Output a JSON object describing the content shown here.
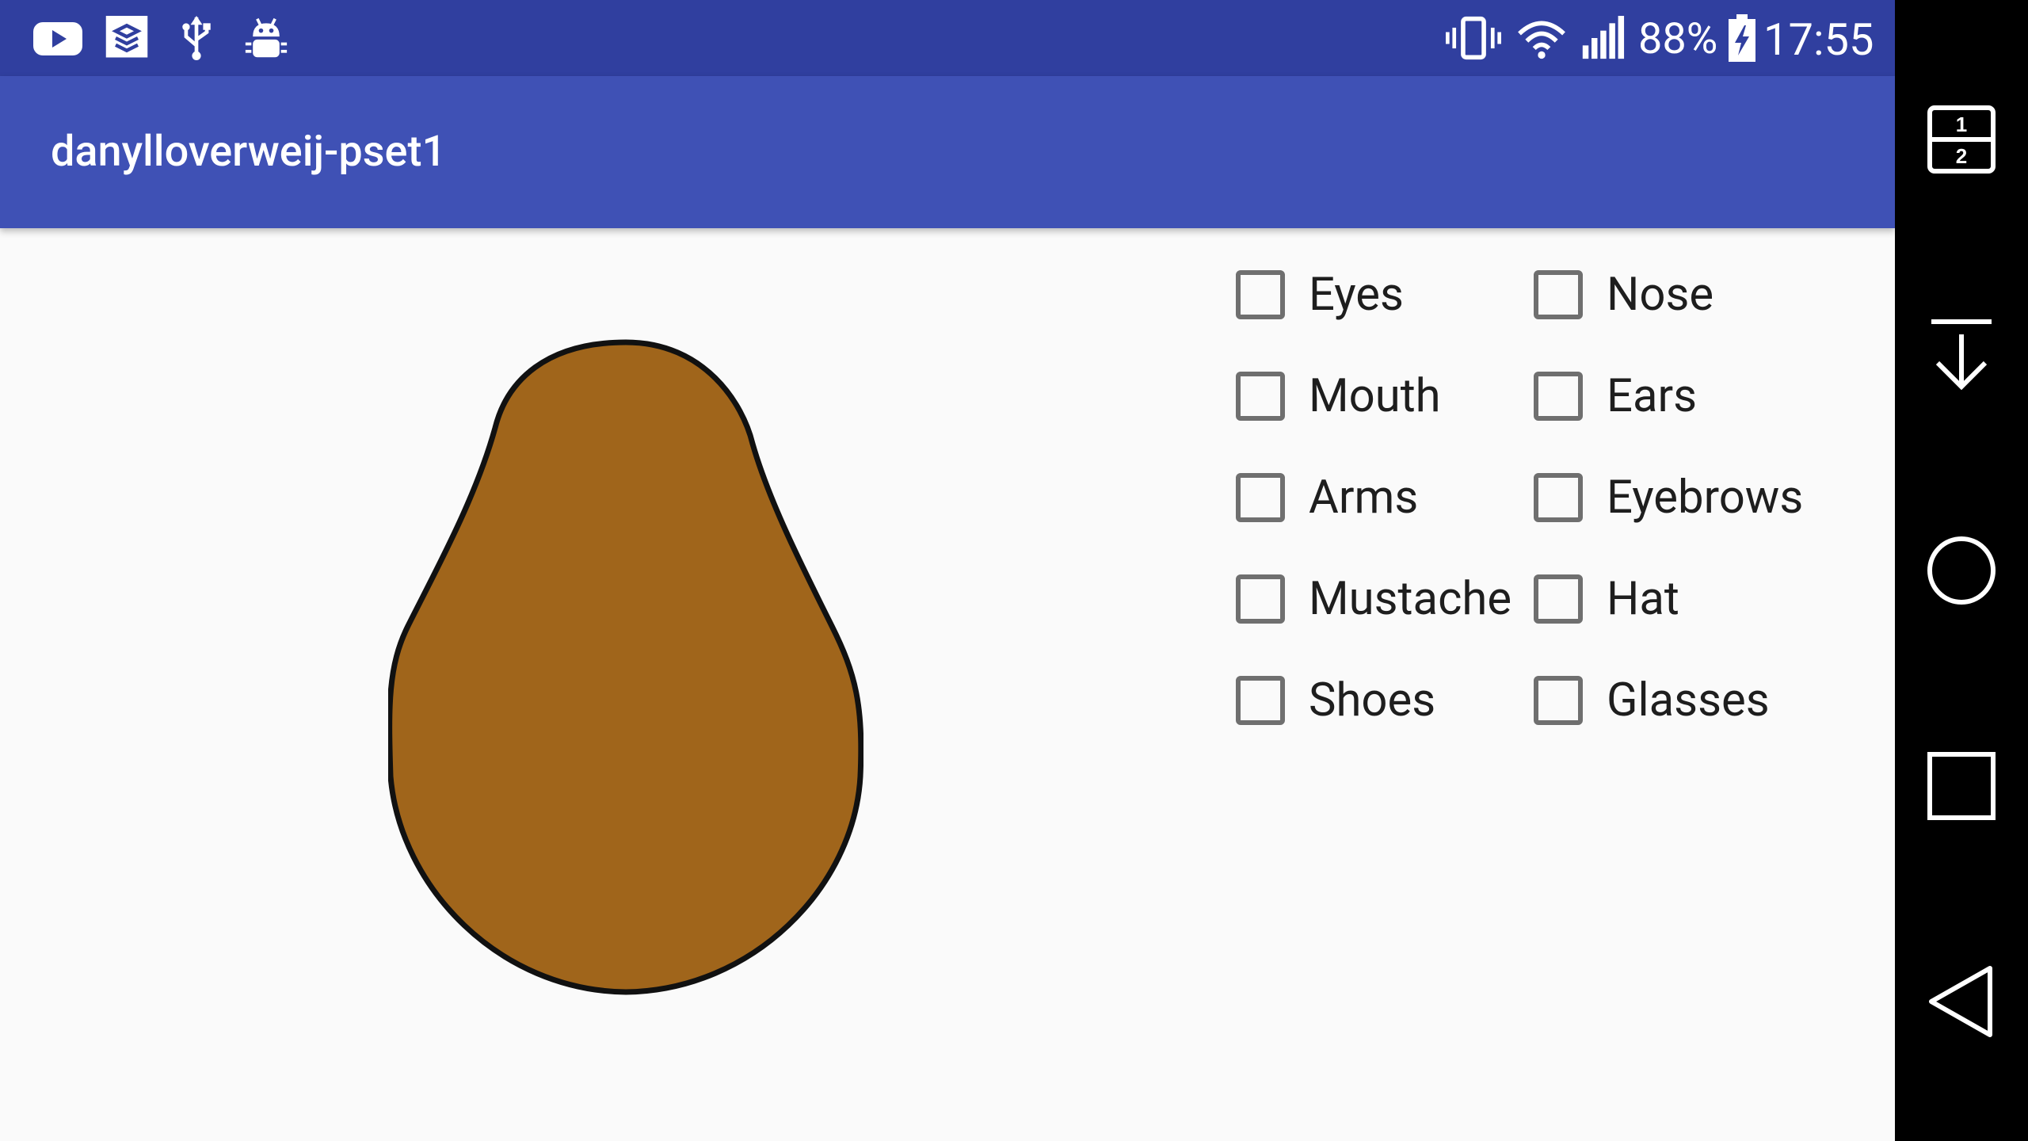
{
  "status_bar": {
    "icons_left": [
      "youtube-icon",
      "workplace-app-icon",
      "usb-icon",
      "android-debug-icon"
    ],
    "icons_right": [
      "vibrate-icon",
      "wifi-icon",
      "cell-signal-icon",
      "battery-charging-icon"
    ],
    "battery": "88%",
    "time": "17:55"
  },
  "app_bar": {
    "title": "danylloverweij-pset1"
  },
  "potato": {
    "fill": "#a0651b",
    "outline": "#111111"
  },
  "checkboxes": [
    {
      "label": "Eyes",
      "checked": false
    },
    {
      "label": "Nose",
      "checked": false
    },
    {
      "label": "Mouth",
      "checked": false
    },
    {
      "label": "Ears",
      "checked": false
    },
    {
      "label": "Arms",
      "checked": false
    },
    {
      "label": "Eyebrows",
      "checked": false
    },
    {
      "label": "Mustache",
      "checked": false
    },
    {
      "label": "Hat",
      "checked": false
    },
    {
      "label": "Shoes",
      "checked": false
    },
    {
      "label": "Glasses",
      "checked": false
    }
  ],
  "nav_bar": {
    "buttons": [
      "split-screen-icon",
      "download-icon",
      "home-icon",
      "recents-icon",
      "back-icon"
    ],
    "split_labels": [
      "1",
      "2"
    ]
  },
  "colors": {
    "status": "#303f9f",
    "primary": "#3f51b5",
    "background": "#fafafa"
  }
}
